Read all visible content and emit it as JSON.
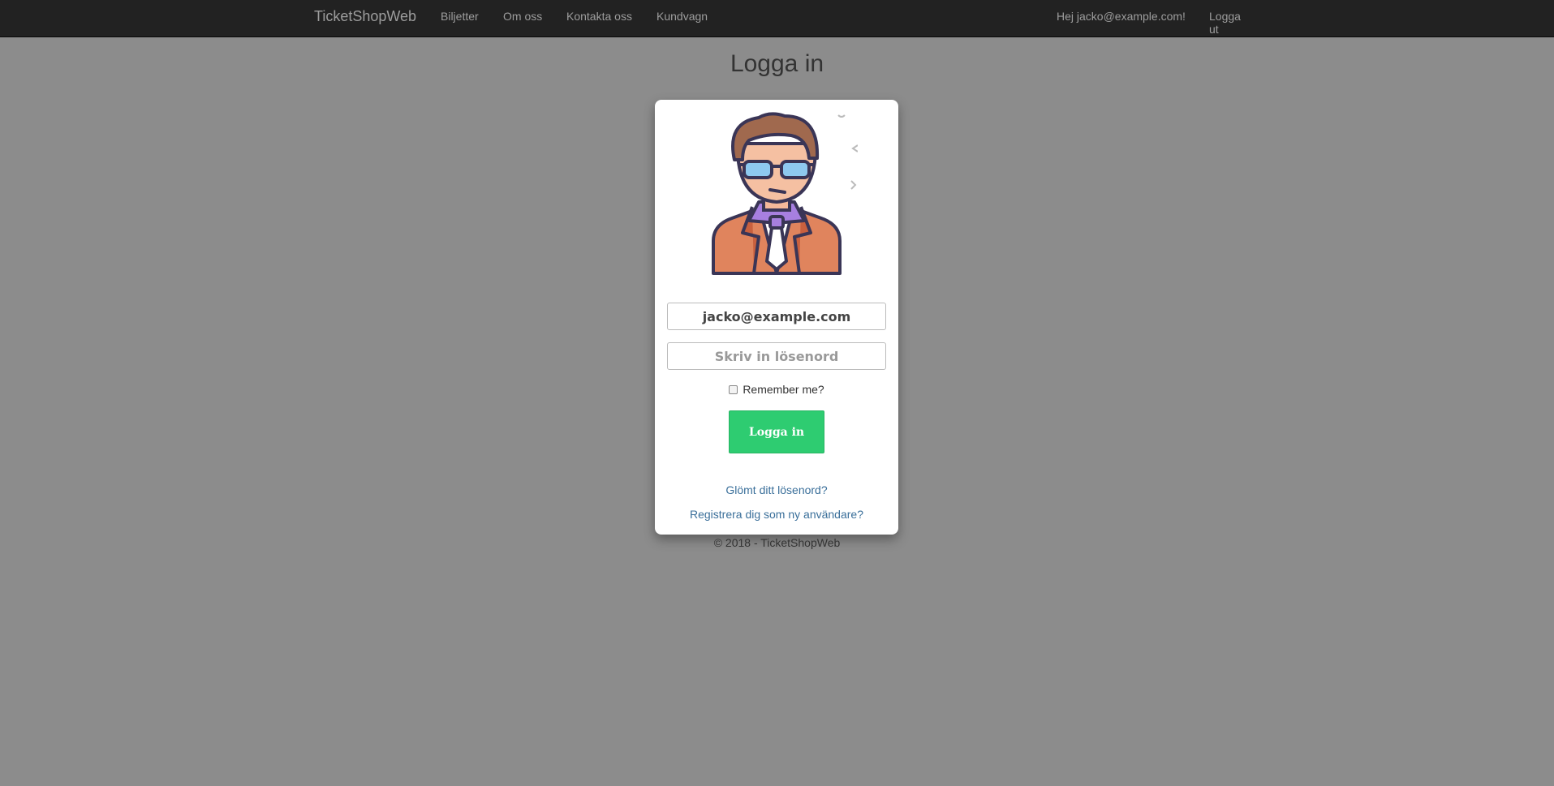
{
  "navbar": {
    "brand": "TicketShopWeb",
    "links": [
      "Biljetter",
      "Om oss",
      "Kontakta oss",
      "Kundvagn"
    ],
    "greeting": "Hej jacko@example.com!",
    "logout": "Logga ut"
  },
  "page": {
    "title": "Logga in"
  },
  "form": {
    "email_value": "jacko@example.com",
    "password_placeholder": "Skriv in lösenord",
    "remember_label": "Remember me?",
    "remember_checked": false,
    "login_button": "Logga in",
    "forgot_link": "Glömt ditt lösenord?",
    "register_link": "Registrera dig som ny användare?"
  },
  "footer": {
    "text": "© 2018 - TicketShopWeb"
  },
  "colors": {
    "navbar_bg": "#222222",
    "page_bg": "#8c8c8c",
    "button_green": "#2ecc71",
    "link_blue": "#3a6f9a"
  },
  "icons": {
    "avatar": "businessman-avatar-icon"
  }
}
